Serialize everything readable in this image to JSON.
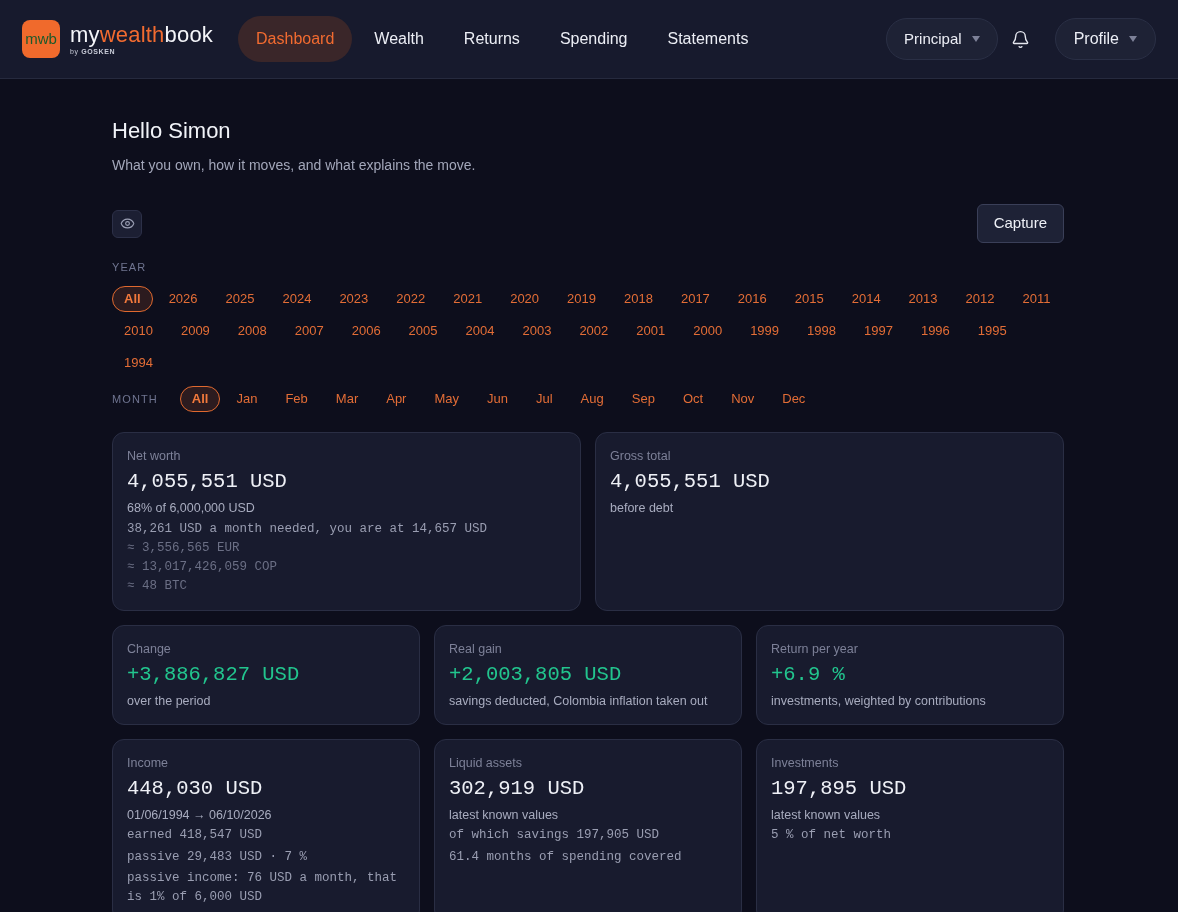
{
  "header": {
    "logo": {
      "mark": "mwb",
      "name_start": "my",
      "name_accent": "wealth",
      "name_end": "book",
      "byline": "by **GOSKEN**"
    },
    "nav": [
      {
        "label": "Dashboard",
        "selected": true
      },
      {
        "label": "Wealth",
        "selected": false
      },
      {
        "label": "Returns",
        "selected": false
      },
      {
        "label": "Spending",
        "selected": false
      },
      {
        "label": "Statements",
        "selected": false
      }
    ],
    "account_menu": {
      "label": "Principal"
    },
    "profile_menu": {
      "label": "Profile"
    }
  },
  "greeting": {
    "title": "Hello Simon",
    "subtitle": "What you own, how it moves, and what explains the move."
  },
  "toolbar": {
    "capture_button": "Capture"
  },
  "year_filter": {
    "label": "YEAR",
    "options": [
      {
        "label": "All",
        "selected": true
      },
      {
        "label": "2026",
        "selected": false
      },
      {
        "label": "2025",
        "selected": false
      },
      {
        "label": "2024",
        "selected": false
      },
      {
        "label": "2023",
        "selected": false
      },
      {
        "label": "2022",
        "selected": false
      },
      {
        "label": "2021",
        "selected": false
      },
      {
        "label": "2020",
        "selected": false
      },
      {
        "label": "2019",
        "selected": false
      },
      {
        "label": "2018",
        "selected": false
      },
      {
        "label": "2017",
        "selected": false
      },
      {
        "label": "2016",
        "selected": false
      },
      {
        "label": "2015",
        "selected": false
      },
      {
        "label": "2014",
        "selected": false
      },
      {
        "label": "2013",
        "selected": false
      },
      {
        "label": "2012",
        "selected": false
      },
      {
        "label": "2011",
        "selected": false
      },
      {
        "label": "2010",
        "selected": false
      },
      {
        "label": "2009",
        "selected": false
      },
      {
        "label": "2008",
        "selected": false
      },
      {
        "label": "2007",
        "selected": false
      },
      {
        "label": "2006",
        "selected": false
      },
      {
        "label": "2005",
        "selected": false
      },
      {
        "label": "2004",
        "selected": false
      },
      {
        "label": "2003",
        "selected": false
      },
      {
        "label": "2002",
        "selected": false
      },
      {
        "label": "2001",
        "selected": false
      },
      {
        "label": "2000",
        "selected": false
      },
      {
        "label": "1999",
        "selected": false
      },
      {
        "label": "1998",
        "selected": false
      },
      {
        "label": "1997",
        "selected": false
      },
      {
        "label": "1996",
        "selected": false
      },
      {
        "label": "1995",
        "selected": false
      },
      {
        "label": "1994",
        "selected": false
      }
    ]
  },
  "month_filter": {
    "label": "MONTH",
    "options": [
      {
        "label": "All",
        "selected": true
      },
      {
        "label": "Jan",
        "selected": false
      },
      {
        "label": "Feb",
        "selected": false
      },
      {
        "label": "Mar",
        "selected": false
      },
      {
        "label": "Apr",
        "selected": false
      },
      {
        "label": "May",
        "selected": false
      },
      {
        "label": "Jun",
        "selected": false
      },
      {
        "label": "Jul",
        "selected": false
      },
      {
        "label": "Aug",
        "selected": false
      },
      {
        "label": "Sep",
        "selected": false
      },
      {
        "label": "Oct",
        "selected": false
      },
      {
        "label": "Nov",
        "selected": false
      },
      {
        "label": "Dec",
        "selected": false
      }
    ]
  },
  "card_rows": [
    {
      "cards": [
        {
          "label": "Net worth",
          "value": "4,055,551 USD",
          "positive": false,
          "lines": [
            {
              "kind": "note",
              "text": "68% of 6,000,000 USD"
            },
            {
              "kind": "detail",
              "text": "38,261 USD a month needed, you are at 14,657 USD"
            },
            {
              "kind": "approx",
              "text": "≈ 3,556,565 EUR"
            },
            {
              "kind": "approx",
              "text": "≈ 13,017,426,059 COP"
            },
            {
              "kind": "approx",
              "text": "≈ 48 BTC"
            }
          ]
        },
        {
          "label": "Gross total",
          "value": "4,055,551 USD",
          "positive": false,
          "lines": [
            {
              "kind": "note",
              "text": "before debt"
            }
          ]
        }
      ]
    },
    {
      "cards": [
        {
          "label": "Change",
          "value": "+3,886,827 USD",
          "positive": true,
          "lines": [
            {
              "kind": "note",
              "text": "over the period"
            }
          ]
        },
        {
          "label": "Real gain",
          "value": "+2,003,805 USD",
          "positive": true,
          "lines": [
            {
              "kind": "note",
              "text": "savings deducted, Colombia inflation taken out"
            }
          ]
        },
        {
          "label": "Return per year",
          "value": "+6.9 %",
          "positive": true,
          "lines": [
            {
              "kind": "note",
              "text": "investments, weighted by contributions"
            }
          ]
        }
      ]
    },
    {
      "cards": [
        {
          "label": "Income",
          "value": "448,030 USD",
          "positive": false,
          "lines": [
            {
              "kind": "note",
              "text": "01/06/1994 → 06/10/2026"
            },
            {
              "kind": "detail",
              "text": "earned 418,547 USD"
            },
            {
              "kind": "detail",
              "text": "passive 29,483 USD · 7 %"
            },
            {
              "kind": "detail",
              "text": "passive income: 76 USD a month, that is 1% of 6,000 USD"
            }
          ]
        },
        {
          "label": "Liquid assets",
          "value": "302,919 USD",
          "positive": false,
          "lines": [
            {
              "kind": "note",
              "text": "latest known values"
            },
            {
              "kind": "detail",
              "text": "of which savings 197,905 USD"
            },
            {
              "kind": "detail",
              "text": "61.4 months of spending covered"
            }
          ]
        },
        {
          "label": "Investments",
          "value": "197,895 USD",
          "positive": false,
          "lines": [
            {
              "kind": "note",
              "text": "latest known values"
            },
            {
              "kind": "detail",
              "text": "5 % of net worth"
            }
          ]
        }
      ]
    }
  ]
}
